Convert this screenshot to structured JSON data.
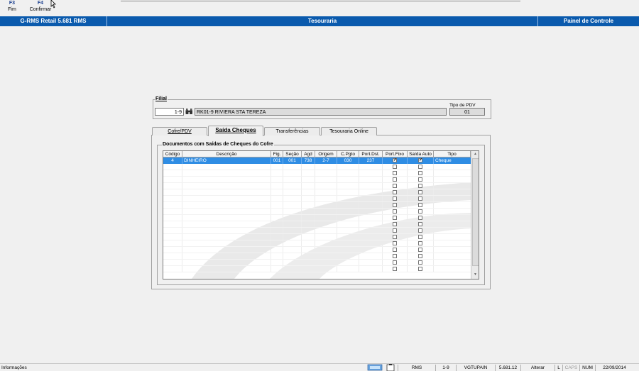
{
  "toolbar": {
    "buttons": [
      {
        "key": "F3",
        "label": "Fim"
      },
      {
        "key": "F4",
        "label": "Confirmar"
      }
    ]
  },
  "titlebar": {
    "app": "G-RMS Retail 5.681 RMS",
    "module": "Tesouraria",
    "panel": "Painel de Controle"
  },
  "filial": {
    "legend": "Filial",
    "code": "1-9",
    "name": "RK01-9 RIVIERA STA TEREZA",
    "tipo_pdv_label": "Tipo de PDV",
    "tipo_pdv_value": "01"
  },
  "tabs": [
    {
      "label": "Cofre/PDV",
      "active": false
    },
    {
      "label": "Saída Cheques",
      "active": true
    },
    {
      "label": "Transferências",
      "active": false
    },
    {
      "label": "Tesouraria Online",
      "active": false
    }
  ],
  "documents": {
    "legend": "Documentos com Saídas de Cheques do Cofre",
    "columns": [
      "Código",
      "Descrição",
      "Fig.",
      "Seção",
      "Agd",
      "Origem",
      "C.Pgto",
      "Port.Dst.",
      "Port.Fixo",
      "Saída Auto",
      "Tipo"
    ],
    "rows": [
      {
        "codigo": "4",
        "descricao": "DINHEIRO",
        "fig": "001",
        "secao": "001",
        "agd": "738",
        "origem": "2-7",
        "cpgto": "030",
        "portdst": "237",
        "portfixo": true,
        "saidaauto": true,
        "tipo": "Cheque"
      }
    ],
    "empty_rows": 17
  },
  "statusbar": {
    "left": "Informações",
    "system": "RMS",
    "filial": "1-9",
    "user": "VGTUPAIN",
    "version": "5.681.12",
    "mode": "Alterar",
    "l": "L",
    "caps": "CAPS",
    "num": "NUM",
    "date": "22/09/2014"
  }
}
